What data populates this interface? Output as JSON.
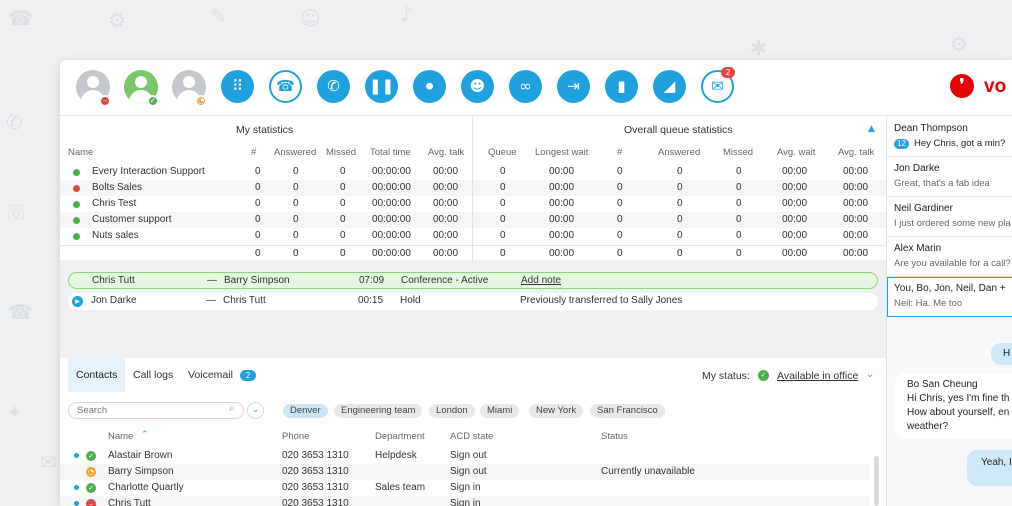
{
  "toolbar": {
    "user_statuses": [
      "busy",
      "available",
      "away"
    ],
    "chat_badge": "2"
  },
  "brand": {
    "name": "Vodafone",
    "visible_text": "vo"
  },
  "my_statistics": {
    "title": "My statistics",
    "columns": [
      "Name",
      "#",
      "Answered",
      "Missed",
      "Total time",
      "Avg. talk"
    ]
  },
  "overall_statistics": {
    "title": "Overall queue statistics",
    "columns": [
      "Queue",
      "Longest wait",
      "#",
      "Answered",
      "Missed",
      "Avg. wait",
      "Avg. talk"
    ]
  },
  "queues": [
    {
      "name": "Every Interaction Support",
      "status_color": "#4caf50",
      "mine": [
        "0",
        "0",
        "0",
        "00:00:00",
        "00:00"
      ],
      "overall": [
        "0",
        "00:00",
        "0",
        "0",
        "0",
        "00:00",
        "00:00"
      ]
    },
    {
      "name": "Bolts Sales",
      "status_color": "#e04646",
      "mine": [
        "0",
        "0",
        "0",
        "00:00:00",
        "00:00"
      ],
      "overall": [
        "0",
        "00:00",
        "0",
        "0",
        "0",
        "00:00",
        "00:00"
      ]
    },
    {
      "name": "Chris Test",
      "status_color": "#4caf50",
      "mine": [
        "0",
        "0",
        "0",
        "00:00:00",
        "00:00"
      ],
      "overall": [
        "0",
        "00:00",
        "0",
        "0",
        "0",
        "00:00",
        "00:00"
      ]
    },
    {
      "name": "Customer support",
      "status_color": "#4caf50",
      "mine": [
        "0",
        "0",
        "0",
        "00:00:00",
        "00:00"
      ],
      "overall": [
        "0",
        "00:00",
        "0",
        "0",
        "0",
        "00:00",
        "00:00"
      ]
    },
    {
      "name": "Nuts sales",
      "status_color": "#4caf50",
      "mine": [
        "0",
        "0",
        "0",
        "00:00:00",
        "00:00"
      ],
      "overall": [
        "0",
        "00:00",
        "0",
        "0",
        "0",
        "00:00",
        "00:00"
      ]
    }
  ],
  "totals": {
    "mine": [
      "0",
      "0",
      "0",
      "00:00:00",
      "00:00"
    ],
    "overall": [
      "0",
      "00:00",
      "0",
      "0",
      "0",
      "00:00",
      "00:00"
    ]
  },
  "calls": [
    {
      "from": "Chris Tutt",
      "sep": "—",
      "to": "Barry Simpson",
      "time": "07:09",
      "state": "Conference - Active",
      "note": "Add note"
    },
    {
      "from": "Jon Darke",
      "sep": "—",
      "to": "Chris Tutt",
      "time": "00:15",
      "state": "Hold",
      "note": "Previously transferred to Sally Jones"
    }
  ],
  "contacts_panel": {
    "tabs": [
      "Contacts",
      "Call logs",
      "Voicemail"
    ],
    "voicemail_badge": "2",
    "my_status_label": "My status:",
    "my_status_value": "Available in office",
    "search_placeholder": "Search",
    "locations": [
      "Denver",
      "Engineering team",
      "London",
      "Miami",
      "New York",
      "San Francisco"
    ],
    "columns": [
      "Name",
      "Phone",
      "Department",
      "ACD state",
      "Status"
    ],
    "rows": [
      {
        "name": "Alastair Brown",
        "presence": "available",
        "phone": "020 3653 1310",
        "department": "Helpdesk",
        "acd": "Sign out",
        "status": ""
      },
      {
        "name": "Barry Simpson",
        "presence": "away",
        "phone": "020 3653 1310",
        "department": "",
        "acd": "Sign out",
        "status": "Currently unavailable"
      },
      {
        "name": "Charlotte Quartly",
        "presence": "available",
        "phone": "020 3653 1310",
        "department": "Sales team",
        "acd": "Sign in",
        "status": ""
      },
      {
        "name": "Chris Tutt",
        "presence": "busy",
        "phone": "020 3653 1310",
        "department": "",
        "acd": "Sign in",
        "status": ""
      }
    ]
  },
  "chat": {
    "conversations": [
      {
        "name": "Dean Thompson",
        "badge": "12",
        "preview": "Hey Chris, got a min?"
      },
      {
        "name": "Jon Darke",
        "preview": "Great, that's a fab idea"
      },
      {
        "name": "Neil Gardiner",
        "preview": "I just ordered some new pla"
      },
      {
        "name": "Alex Marin",
        "preview": "Are you available for a call?"
      },
      {
        "name": "You, Bo, Jon, Neil, Dan +",
        "preview": "Neil: Ha. Me too"
      }
    ],
    "messages": [
      {
        "from": "me",
        "text": "H"
      },
      {
        "from": "other",
        "sender": "Bo San Cheung",
        "lines": [
          "Hi Chris, yes I'm fine th",
          "How about yourself, en",
          "weather?"
        ]
      },
      {
        "from": "me",
        "text": "Yeah, I"
      }
    ]
  }
}
